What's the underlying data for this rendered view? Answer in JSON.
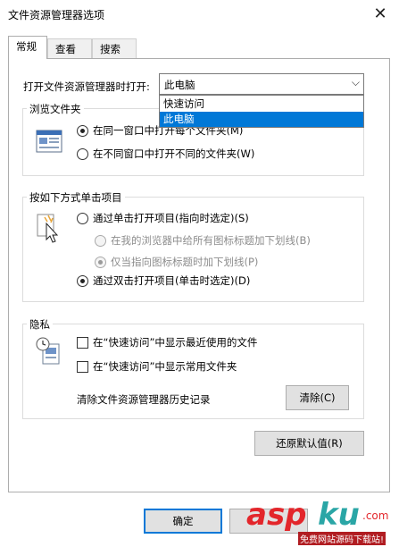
{
  "window": {
    "title": "文件资源管理器选项",
    "close_glyph": "✕"
  },
  "tabs": [
    {
      "label": "常规",
      "active": true
    },
    {
      "label": "查看",
      "active": false
    },
    {
      "label": "搜索",
      "active": false
    }
  ],
  "open_with": {
    "label": "打开文件资源管理器时打开:",
    "selected": "此电脑",
    "arrow_glyph": "⌵",
    "options": [
      "快速访问",
      "此电脑"
    ]
  },
  "browse_folders": {
    "title": "浏览文件夹",
    "icon": "folder-window-icon",
    "options": [
      {
        "label": "在同一窗口中打开每个文件夹(M)",
        "checked": true
      },
      {
        "label": "在不同窗口中打开不同的文件夹(W)",
        "checked": false
      }
    ]
  },
  "click_items": {
    "title": "按如下方式单击项目",
    "icon": "pointer-click-icon",
    "single_click": {
      "label": "通过单击打开项目(指向时选定)(S)",
      "checked": false
    },
    "underline_options": [
      {
        "label": "在我的浏览器中给所有图标标题加下划线(B)",
        "checked": false,
        "disabled": true
      },
      {
        "label": "仅当指向图标标题时加下划线(P)",
        "checked": true,
        "disabled": true
      }
    ],
    "double_click": {
      "label": "通过双击打开项目(单击时选定)(D)",
      "checked": true
    }
  },
  "privacy": {
    "title": "隐私",
    "icon": "history-document-icon",
    "checkboxes": [
      {
        "label": "在“快速访问”中显示最近使用的文件",
        "checked": false
      },
      {
        "label": "在“快速访问”中显示常用文件夹",
        "checked": false
      }
    ],
    "clear_label": "清除文件资源管理器历史记录",
    "clear_button": "清除(C)"
  },
  "restore_defaults_button": "还原默认值(R)",
  "footer": {
    "ok_button": "确定"
  },
  "watermark": {
    "brand_a": "asp",
    "brand_b": "ku",
    "brand_c": ".com",
    "caption": "免费网站源码下载站!"
  },
  "colors": {
    "accent": "#0078d7",
    "watermark_red": "#e3262b",
    "watermark_teal": "#2aa6a6"
  }
}
